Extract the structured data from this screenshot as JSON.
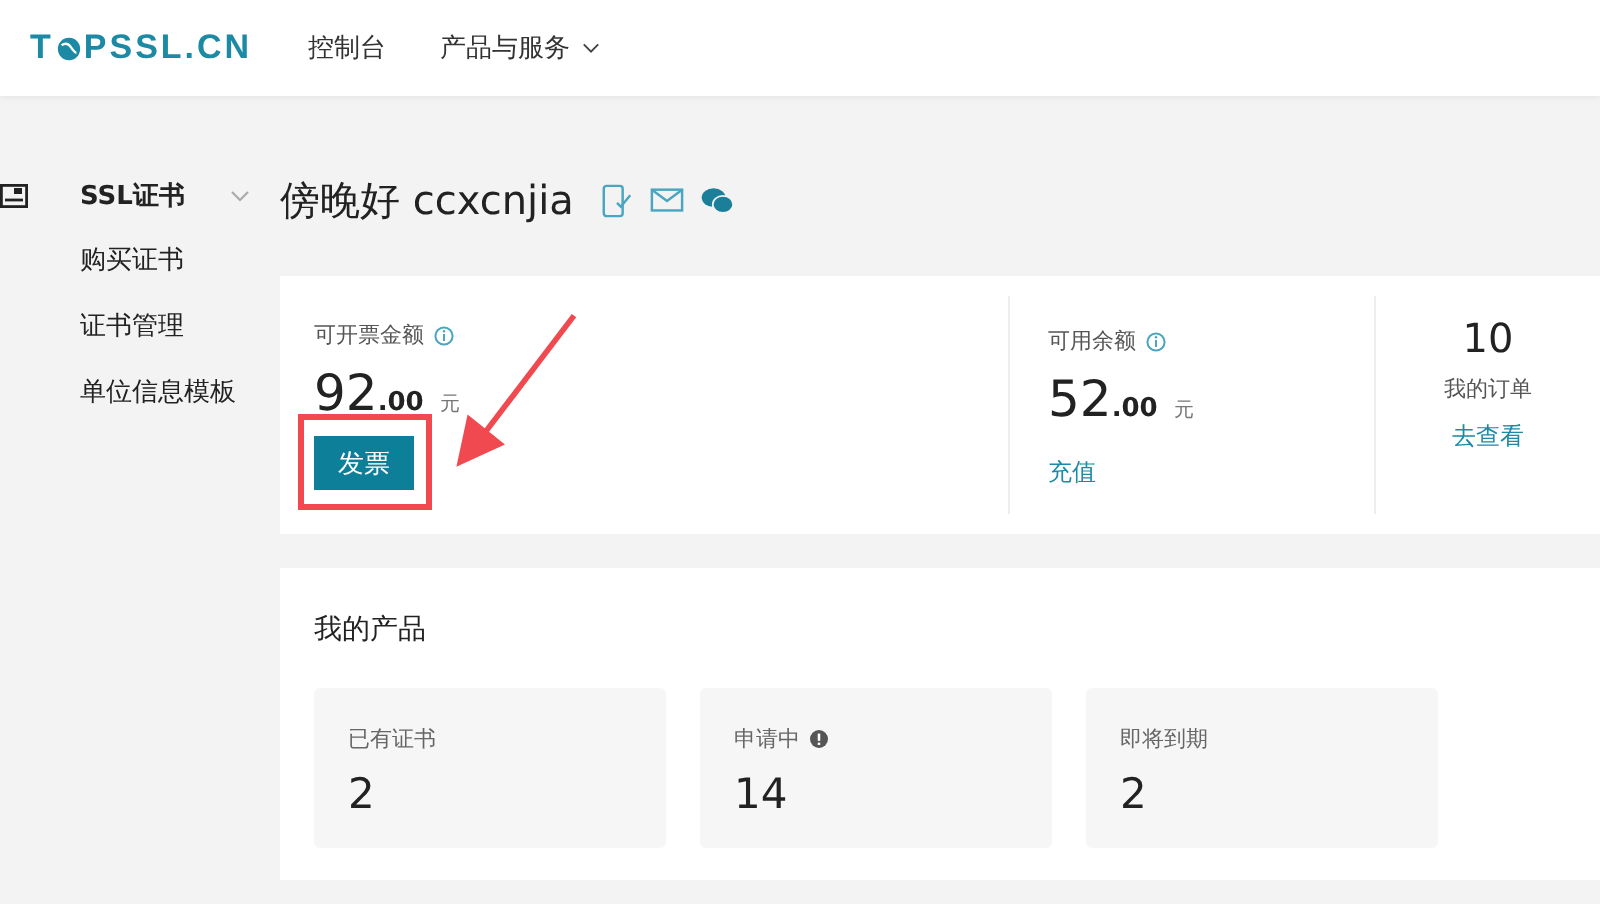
{
  "header": {
    "logo_parts": [
      "T",
      "PSSL.CN"
    ],
    "nav": [
      {
        "label": "控制台",
        "has_dropdown": false
      },
      {
        "label": "产品与服务",
        "has_dropdown": true
      }
    ]
  },
  "sidebar": {
    "section": {
      "label": "SSL证书",
      "expanded": true
    },
    "items": [
      {
        "label": "购买证书"
      },
      {
        "label": "证书管理"
      },
      {
        "label": "单位信息模板"
      }
    ]
  },
  "greeting": "傍晚好 ccxcnjia",
  "summary": {
    "invoice": {
      "label": "可开票金额",
      "integer": "92",
      "decimal": ".00",
      "unit": "元",
      "button": "发票"
    },
    "balance": {
      "label": "可用余额",
      "integer": "52",
      "decimal": ".00",
      "unit": "元",
      "link": "充值"
    },
    "orders": {
      "count": "10",
      "label": "我的订单",
      "link": "去查看"
    }
  },
  "products": {
    "title": "我的产品",
    "tiles": [
      {
        "label": "已有证书",
        "value": "2",
        "notice": false
      },
      {
        "label": "申请中",
        "value": "14",
        "notice": true
      },
      {
        "label": "即将到期",
        "value": "2",
        "notice": false
      }
    ]
  }
}
